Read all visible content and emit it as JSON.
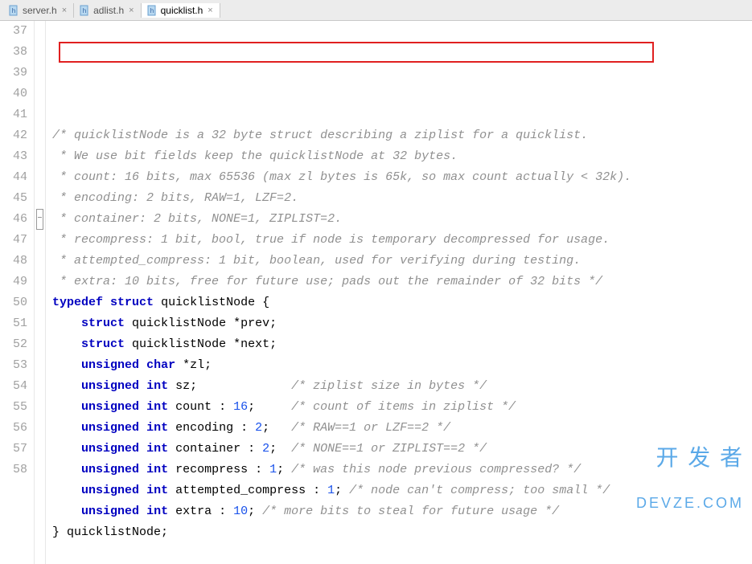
{
  "tabs": [
    {
      "icon": "h-file-icon",
      "label": "server.h",
      "active": false
    },
    {
      "icon": "h-file-icon",
      "label": "adlist.h",
      "active": false
    },
    {
      "icon": "h-file-icon",
      "label": "quicklist.h",
      "active": true
    }
  ],
  "watermark": {
    "line1": "开 发 者",
    "line2": "DEVZE.COM"
  },
  "lines": [
    {
      "num": 37,
      "fold": "",
      "segments": []
    },
    {
      "num": 38,
      "fold": "",
      "segments": [
        {
          "cls": "comment",
          "text": "/* quicklistNode is a 32 byte struct describing a ziplist for a quicklist."
        }
      ]
    },
    {
      "num": 39,
      "fold": "",
      "segments": [
        {
          "cls": "comment",
          "text": " * We use bit fields keep the quicklistNode at 32 bytes."
        }
      ]
    },
    {
      "num": 40,
      "fold": "",
      "segments": [
        {
          "cls": "comment",
          "text": " * count: 16 bits, max 65536 (max zl bytes is 65k, so max count actually < 32k)."
        }
      ]
    },
    {
      "num": 41,
      "fold": "",
      "segments": [
        {
          "cls": "comment",
          "text": " * encoding: 2 bits, RAW=1, LZF=2."
        }
      ]
    },
    {
      "num": 42,
      "fold": "",
      "segments": [
        {
          "cls": "comment",
          "text": " * container: 2 bits, NONE=1, ZIPLIST=2."
        }
      ]
    },
    {
      "num": 43,
      "fold": "",
      "segments": [
        {
          "cls": "comment",
          "text": " * recompress: 1 bit, bool, true if node is temporary decompressed for usage."
        }
      ]
    },
    {
      "num": 44,
      "fold": "",
      "segments": [
        {
          "cls": "comment",
          "text": " * attempted_compress: 1 bit, boolean, used for verifying during testing."
        }
      ]
    },
    {
      "num": 45,
      "fold": "",
      "segments": [
        {
          "cls": "comment",
          "text": " * extra: 10 bits, free for future use; pads out the remainder of 32 bits */"
        }
      ]
    },
    {
      "num": 46,
      "fold": "open",
      "segments": [
        {
          "cls": "keyword",
          "text": "typedef"
        },
        {
          "cls": "ident",
          "text": " "
        },
        {
          "cls": "keyword",
          "text": "struct"
        },
        {
          "cls": "ident",
          "text": " quicklistNode {"
        }
      ]
    },
    {
      "num": 47,
      "fold": "",
      "segments": [
        {
          "cls": "ident",
          "text": "    "
        },
        {
          "cls": "keyword",
          "text": "struct"
        },
        {
          "cls": "ident",
          "text": " quicklistNode *prev;"
        }
      ]
    },
    {
      "num": 48,
      "fold": "",
      "segments": [
        {
          "cls": "ident",
          "text": "    "
        },
        {
          "cls": "keyword",
          "text": "struct"
        },
        {
          "cls": "ident",
          "text": " quicklistNode *next;"
        }
      ]
    },
    {
      "num": 49,
      "fold": "",
      "segments": [
        {
          "cls": "ident",
          "text": "    "
        },
        {
          "cls": "keyword",
          "text": "unsigned"
        },
        {
          "cls": "ident",
          "text": " "
        },
        {
          "cls": "keyword",
          "text": "char"
        },
        {
          "cls": "ident",
          "text": " *zl;"
        }
      ]
    },
    {
      "num": 50,
      "fold": "",
      "segments": [
        {
          "cls": "ident",
          "text": "    "
        },
        {
          "cls": "keyword",
          "text": "unsigned"
        },
        {
          "cls": "ident",
          "text": " "
        },
        {
          "cls": "keyword",
          "text": "int"
        },
        {
          "cls": "ident",
          "text": " sz;             "
        },
        {
          "cls": "comment",
          "text": "/* ziplist size in bytes */"
        }
      ]
    },
    {
      "num": 51,
      "fold": "",
      "segments": [
        {
          "cls": "ident",
          "text": "    "
        },
        {
          "cls": "keyword",
          "text": "unsigned"
        },
        {
          "cls": "ident",
          "text": " "
        },
        {
          "cls": "keyword",
          "text": "int"
        },
        {
          "cls": "ident",
          "text": " count : "
        },
        {
          "cls": "num",
          "text": "16"
        },
        {
          "cls": "ident",
          "text": ";     "
        },
        {
          "cls": "comment",
          "text": "/* count of items in ziplist */"
        }
      ]
    },
    {
      "num": 52,
      "fold": "",
      "segments": [
        {
          "cls": "ident",
          "text": "    "
        },
        {
          "cls": "keyword",
          "text": "unsigned"
        },
        {
          "cls": "ident",
          "text": " "
        },
        {
          "cls": "keyword",
          "text": "int"
        },
        {
          "cls": "ident",
          "text": " encoding : "
        },
        {
          "cls": "num",
          "text": "2"
        },
        {
          "cls": "ident",
          "text": ";   "
        },
        {
          "cls": "comment",
          "text": "/* RAW==1 or LZF==2 */"
        }
      ]
    },
    {
      "num": 53,
      "fold": "",
      "segments": [
        {
          "cls": "ident",
          "text": "    "
        },
        {
          "cls": "keyword",
          "text": "unsigned"
        },
        {
          "cls": "ident",
          "text": " "
        },
        {
          "cls": "keyword",
          "text": "int"
        },
        {
          "cls": "ident",
          "text": " container : "
        },
        {
          "cls": "num",
          "text": "2"
        },
        {
          "cls": "ident",
          "text": ";  "
        },
        {
          "cls": "comment",
          "text": "/* NONE==1 or ZIPLIST==2 */"
        }
      ]
    },
    {
      "num": 54,
      "fold": "",
      "segments": [
        {
          "cls": "ident",
          "text": "    "
        },
        {
          "cls": "keyword",
          "text": "unsigned"
        },
        {
          "cls": "ident",
          "text": " "
        },
        {
          "cls": "keyword",
          "text": "int"
        },
        {
          "cls": "ident",
          "text": " recompress : "
        },
        {
          "cls": "num",
          "text": "1"
        },
        {
          "cls": "ident",
          "text": "; "
        },
        {
          "cls": "comment",
          "text": "/* was this node previous compressed? */"
        }
      ]
    },
    {
      "num": 55,
      "fold": "",
      "segments": [
        {
          "cls": "ident",
          "text": "    "
        },
        {
          "cls": "keyword",
          "text": "unsigned"
        },
        {
          "cls": "ident",
          "text": " "
        },
        {
          "cls": "keyword",
          "text": "int"
        },
        {
          "cls": "ident",
          "text": " attempted_compress : "
        },
        {
          "cls": "num",
          "text": "1"
        },
        {
          "cls": "ident",
          "text": "; "
        },
        {
          "cls": "comment",
          "text": "/* node can't compress; too small */"
        }
      ]
    },
    {
      "num": 56,
      "fold": "",
      "segments": [
        {
          "cls": "ident",
          "text": "    "
        },
        {
          "cls": "keyword",
          "text": "unsigned"
        },
        {
          "cls": "ident",
          "text": " "
        },
        {
          "cls": "keyword",
          "text": "int"
        },
        {
          "cls": "ident",
          "text": " extra : "
        },
        {
          "cls": "num",
          "text": "10"
        },
        {
          "cls": "ident",
          "text": "; "
        },
        {
          "cls": "comment",
          "text": "/* more bits to steal for future usage */"
        }
      ]
    },
    {
      "num": 57,
      "fold": "close",
      "segments": [
        {
          "cls": "ident",
          "text": "} quicklistNode;"
        }
      ]
    },
    {
      "num": 58,
      "fold": "",
      "segments": []
    }
  ]
}
